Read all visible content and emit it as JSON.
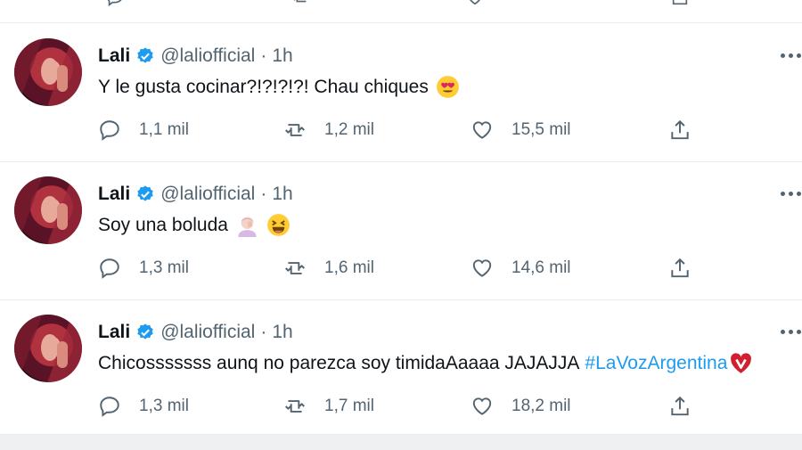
{
  "tweets": [
    {
      "author": {
        "name": "Lali",
        "handle": "@laliofficial",
        "verified": true
      },
      "time": "1h",
      "text": "Y le gusta cocinar?!?!?!?! Chau chiques",
      "emojis": [
        "heart-eyes-emoji"
      ],
      "hashtag": "",
      "replies": "1,1 mil",
      "retweets": "1,2 mil",
      "likes": "15,5 mil"
    },
    {
      "author": {
        "name": "Lali",
        "handle": "@laliofficial",
        "verified": true
      },
      "time": "1h",
      "text": "Soy una boluda",
      "emojis": [
        "facepalm-emoji",
        "laughing-emoji"
      ],
      "hashtag": "",
      "replies": "1,3 mil",
      "retweets": "1,6 mil",
      "likes": "14,6 mil"
    },
    {
      "author": {
        "name": "Lali",
        "handle": "@laliofficial",
        "verified": true
      },
      "time": "1h",
      "text": "Chicosssssss aunq no parezca soy timidaAaaaa JAJAJJA",
      "emojis": [
        "la-voz-heart-emoji"
      ],
      "hashtag": "#LaVozArgentina",
      "replies": "1,3 mil",
      "retweets": "1,7 mil",
      "likes": "18,2 mil"
    }
  ],
  "colors": {
    "accent": "#1d9bf0",
    "muted": "#536471",
    "text": "#0f1419",
    "divider": "#e8ecef"
  },
  "icons": [
    "reply-icon",
    "retweet-icon",
    "like-icon",
    "share-icon",
    "more-icon",
    "verified-badge-icon"
  ]
}
